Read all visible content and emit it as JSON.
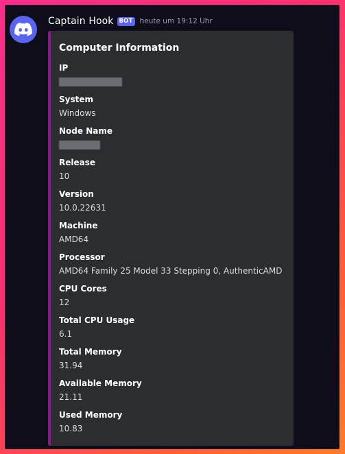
{
  "message": {
    "username": "Captain Hook",
    "badge": "BOT",
    "timestamp": "heute um 19:12 Uhr",
    "avatar_icon": "discord-logo-icon"
  },
  "embed": {
    "accent_color": "#8a1a8a",
    "title": "Computer Information",
    "fields": [
      {
        "name": "IP",
        "value": "",
        "redacted": true
      },
      {
        "name": "System",
        "value": "Windows"
      },
      {
        "name": "Node Name",
        "value": "",
        "redacted": true
      },
      {
        "name": "Release",
        "value": "10"
      },
      {
        "name": "Version",
        "value": "10.0.22631"
      },
      {
        "name": "Machine",
        "value": "AMD64"
      },
      {
        "name": "Processor",
        "value": "AMD64 Family 25 Model 33 Stepping 0, AuthenticAMD"
      },
      {
        "name": "CPU Cores",
        "value": "12"
      },
      {
        "name": "Total CPU Usage",
        "value": "6.1"
      },
      {
        "name": "Total Memory",
        "value": "31.94"
      },
      {
        "name": "Available Memory",
        "value": "21.11"
      },
      {
        "name": "Used Memory",
        "value": "10.83"
      }
    ]
  }
}
